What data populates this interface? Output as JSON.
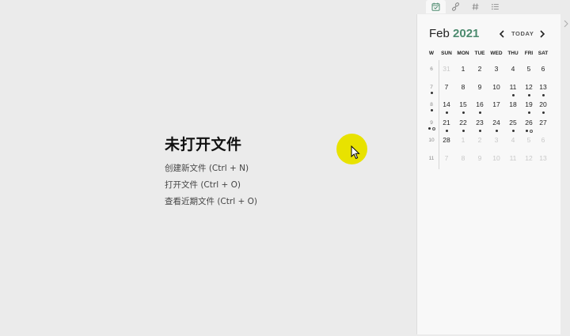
{
  "empty_state": {
    "title": "未打开文件",
    "actions": [
      "创建新文件 (Ctrl + N)",
      "打开文件 (Ctrl + O)",
      "查看近期文件 (Ctrl + O)"
    ]
  },
  "sidebar": {
    "tabs": [
      {
        "icon": "calendar-check-icon",
        "active": true
      },
      {
        "icon": "link-icon",
        "active": false
      },
      {
        "icon": "hash-icon",
        "active": false
      },
      {
        "icon": "list-icon",
        "active": false
      }
    ]
  },
  "calendar": {
    "month": "Feb",
    "year": "2021",
    "today_label": "TODAY",
    "week_label": "W",
    "weekdays": [
      "SUN",
      "MON",
      "TUE",
      "WED",
      "THU",
      "FRI",
      "SAT"
    ],
    "weeks": [
      {
        "num": "6",
        "num_dot": false,
        "days": [
          {
            "d": "31",
            "faded": true,
            "dots": 0,
            "hollow": 0
          },
          {
            "d": "1",
            "faded": false,
            "dots": 0,
            "hollow": 0
          },
          {
            "d": "2",
            "faded": false,
            "dots": 0,
            "hollow": 0
          },
          {
            "d": "3",
            "faded": false,
            "dots": 0,
            "hollow": 0
          },
          {
            "d": "4",
            "faded": false,
            "dots": 0,
            "hollow": 0
          },
          {
            "d": "5",
            "faded": false,
            "dots": 0,
            "hollow": 0
          },
          {
            "d": "6",
            "faded": false,
            "dots": 0,
            "hollow": 0
          }
        ]
      },
      {
        "num": "7",
        "num_dot": true,
        "days": [
          {
            "d": "7",
            "faded": false,
            "dots": 0,
            "hollow": 0
          },
          {
            "d": "8",
            "faded": false,
            "dots": 0,
            "hollow": 0
          },
          {
            "d": "9",
            "faded": false,
            "dots": 0,
            "hollow": 0
          },
          {
            "d": "10",
            "faded": false,
            "dots": 0,
            "hollow": 0
          },
          {
            "d": "11",
            "faded": false,
            "dots": 1,
            "hollow": 0
          },
          {
            "d": "12",
            "faded": false,
            "dots": 1,
            "hollow": 0
          },
          {
            "d": "13",
            "faded": false,
            "dots": 1,
            "hollow": 0
          }
        ]
      },
      {
        "num": "8",
        "num_dot": true,
        "days": [
          {
            "d": "14",
            "faded": false,
            "dots": 1,
            "hollow": 0
          },
          {
            "d": "15",
            "faded": false,
            "dots": 1,
            "hollow": 0
          },
          {
            "d": "16",
            "faded": false,
            "dots": 1,
            "hollow": 0
          },
          {
            "d": "17",
            "faded": false,
            "dots": 0,
            "hollow": 0
          },
          {
            "d": "18",
            "faded": false,
            "dots": 0,
            "hollow": 0
          },
          {
            "d": "19",
            "faded": false,
            "dots": 1,
            "hollow": 0
          },
          {
            "d": "20",
            "faded": false,
            "dots": 1,
            "hollow": 0
          }
        ]
      },
      {
        "num": "9",
        "num_dot": true,
        "num_hollow": true,
        "days": [
          {
            "d": "21",
            "faded": false,
            "dots": 1,
            "hollow": 0
          },
          {
            "d": "22",
            "faded": false,
            "dots": 1,
            "hollow": 0
          },
          {
            "d": "23",
            "faded": false,
            "dots": 1,
            "hollow": 0
          },
          {
            "d": "24",
            "faded": false,
            "dots": 1,
            "hollow": 0
          },
          {
            "d": "25",
            "faded": false,
            "dots": 1,
            "hollow": 0
          },
          {
            "d": "26",
            "faded": false,
            "dots": 1,
            "hollow": 1
          },
          {
            "d": "27",
            "faded": false,
            "dots": 0,
            "hollow": 0
          }
        ]
      },
      {
        "num": "10",
        "num_dot": false,
        "days": [
          {
            "d": "28",
            "faded": false,
            "dots": 0,
            "hollow": 0
          },
          {
            "d": "1",
            "faded": true,
            "dots": 0,
            "hollow": 0
          },
          {
            "d": "2",
            "faded": true,
            "dots": 0,
            "hollow": 0
          },
          {
            "d": "3",
            "faded": true,
            "dots": 0,
            "hollow": 0
          },
          {
            "d": "4",
            "faded": true,
            "dots": 0,
            "hollow": 0
          },
          {
            "d": "5",
            "faded": true,
            "dots": 0,
            "hollow": 0
          },
          {
            "d": "6",
            "faded": true,
            "dots": 0,
            "hollow": 0
          }
        ]
      },
      {
        "num": "11",
        "num_dot": false,
        "days": [
          {
            "d": "7",
            "faded": true,
            "dots": 0,
            "hollow": 0
          },
          {
            "d": "8",
            "faded": true,
            "dots": 0,
            "hollow": 0
          },
          {
            "d": "9",
            "faded": true,
            "dots": 0,
            "hollow": 0
          },
          {
            "d": "10",
            "faded": true,
            "dots": 0,
            "hollow": 0
          },
          {
            "d": "11",
            "faded": true,
            "dots": 0,
            "hollow": 0
          },
          {
            "d": "12",
            "faded": true,
            "dots": 0,
            "hollow": 0
          },
          {
            "d": "13",
            "faded": true,
            "dots": 0,
            "hollow": 0
          }
        ]
      }
    ]
  },
  "colors": {
    "background": "#ebebeb",
    "sidebar": "#f8f8f8",
    "accent_year": "#4d8b6f",
    "cursor_highlight": "#e8e200"
  }
}
